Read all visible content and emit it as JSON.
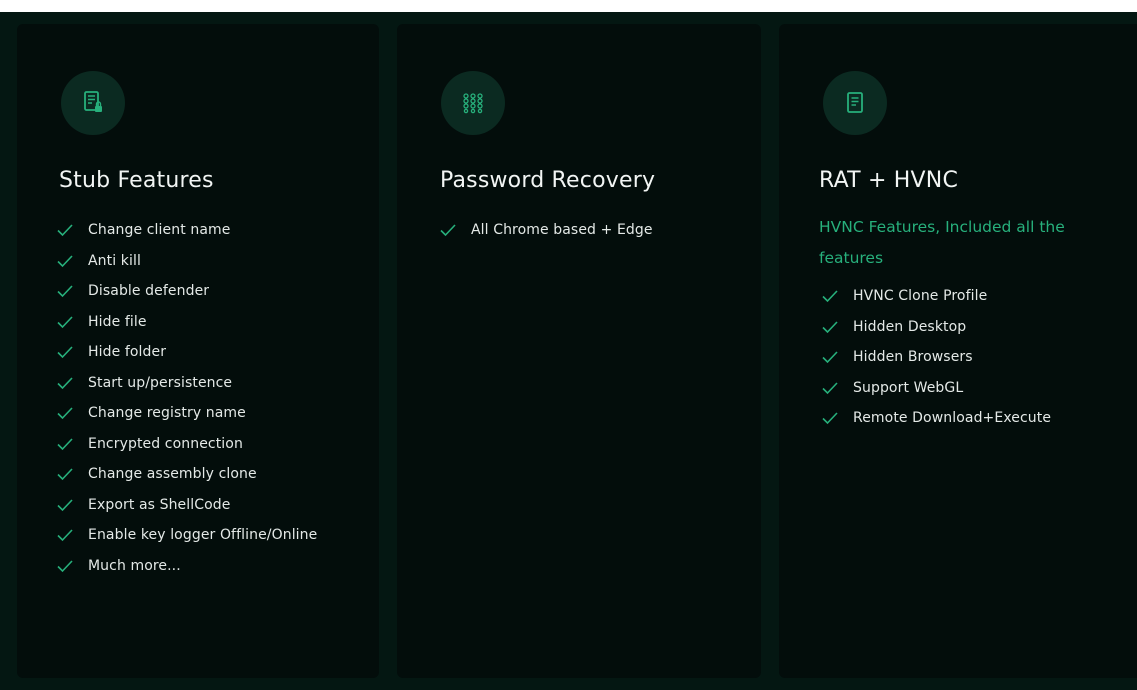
{
  "colors": {
    "page_background": "#041712",
    "card_background": "#030d0b",
    "accent_green": "#27b07c",
    "icon_badge_background": "#0b2a21",
    "title_text": "#f2f5f4",
    "item_text": "#e4e9e7"
  },
  "cards": [
    {
      "icon": "document-lock-icon",
      "title": "Stub Features",
      "items": [
        "Change client name",
        "Anti kill",
        "Disable defender",
        "Hide file",
        "Hide folder",
        "Start up/persistence",
        "Change registry name",
        "Encrypted connection",
        "Change assembly clone",
        "Export as ShellCode",
        "Enable key logger Offline/Online",
        "Much more..."
      ]
    },
    {
      "icon": "keypad-grid-icon",
      "title": "Password Recovery",
      "items": [
        "All Chrome based + Edge"
      ]
    },
    {
      "icon": "document-icon",
      "title": "RAT + HVNC",
      "subtitle": "HVNC Features, Included all the features",
      "items": [
        "HVNC Clone Profile",
        "Hidden Desktop",
        "Hidden Browsers",
        "Support WebGL",
        "Remote Download+Execute"
      ]
    }
  ]
}
